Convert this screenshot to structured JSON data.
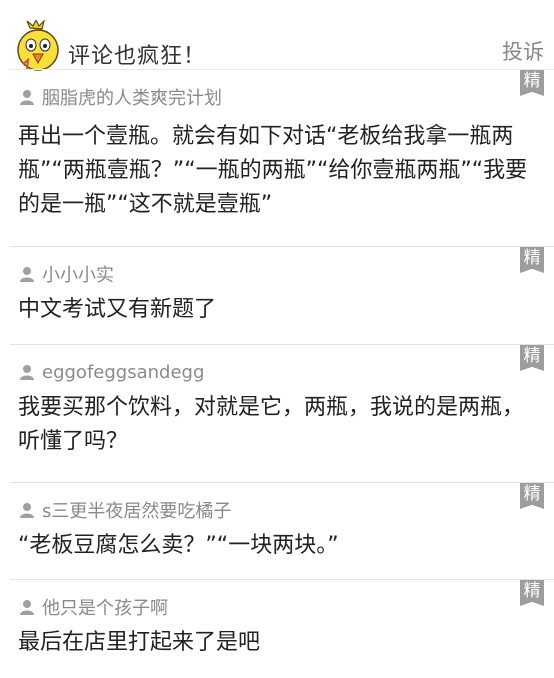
{
  "header": {
    "title": "评论也疯狂！",
    "report_label": "投诉"
  },
  "badge_label": "精",
  "comments": [
    {
      "user": "胭脂虎的人类爽完计划",
      "text": "再出一个壹瓶。就会有如下对话“老板给我拿一瓶两瓶”“两瓶壹瓶？”“一瓶的两瓶”“给你壹瓶两瓶”“我要的是一瓶”“这不就是壹瓶”"
    },
    {
      "user": "小小小实",
      "text": "中文考试又有新题了"
    },
    {
      "user": "eggofeggsandegg",
      "text": "我要买那个饮料，对就是它，两瓶，我说的是两瓶，听懂了吗？"
    },
    {
      "user": "s三更半夜居然要吃橘子",
      "text": "“老板豆腐怎么卖？”“一块两块。”"
    },
    {
      "user": "他只是个孩子啊",
      "text": "最后在店里打起来了是吧"
    }
  ],
  "colors": {
    "badge": "#9d9d9d",
    "username": "#8a8a8a",
    "divider": "#e3e3e3"
  },
  "icons": {
    "mascot": "yellow-chick-mascot-icon",
    "user": "user-silhouette-icon",
    "badge": "featured-bookmark-icon"
  }
}
